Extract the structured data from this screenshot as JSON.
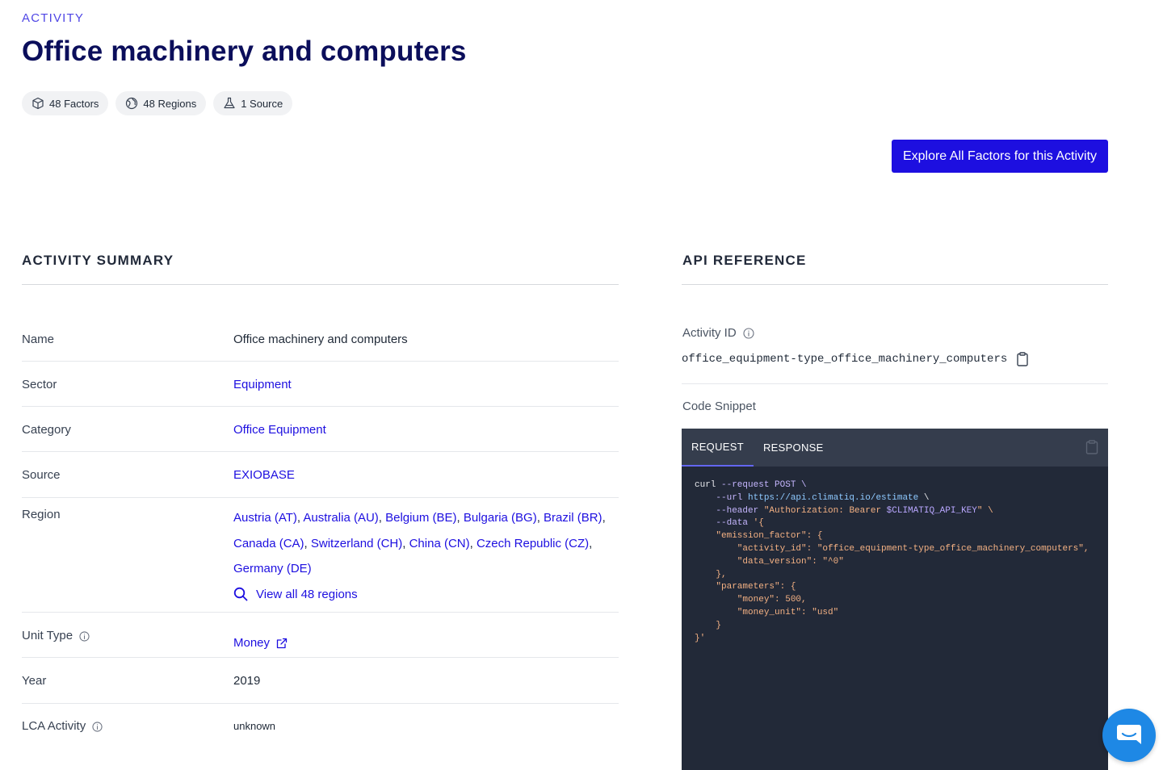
{
  "header": {
    "eyebrow": "ACTIVITY",
    "title": "Office machinery and computers"
  },
  "chips": {
    "factors": "48 Factors",
    "regions": "48 Regions",
    "sources": "1 Source"
  },
  "explore_button": "Explore All Factors for this Activity",
  "summary": {
    "heading": "ACTIVITY SUMMARY",
    "name": {
      "label": "Name",
      "value": "Office machinery and computers"
    },
    "sector": {
      "label": "Sector",
      "value": "Equipment"
    },
    "category": {
      "label": "Category",
      "value": "Office Equipment"
    },
    "source": {
      "label": "Source",
      "value": "EXIOBASE"
    },
    "region": {
      "label": "Region",
      "values": [
        "Austria (AT)",
        "Australia (AU)",
        "Belgium (BE)",
        "Bulgaria (BG)",
        "Brazil (BR)",
        "Canada (CA)",
        "Switzerland (CH)",
        "China (CN)",
        "Czech Republic (CZ)",
        "Germany (DE)"
      ],
      "view_all": "View all 48 regions"
    },
    "unit_type": {
      "label": "Unit Type",
      "value": "Money"
    },
    "year": {
      "label": "Year",
      "value": "2019"
    },
    "lca_activity": {
      "label": "LCA Activity",
      "value": "unknown"
    }
  },
  "api": {
    "heading": "API REFERENCE",
    "activity_id_label": "Activity ID",
    "activity_id": "office_equipment-type_office_machinery_computers",
    "code_snippet_label": "Code Snippet",
    "tabs": [
      "REQUEST",
      "RESPONSE"
    ],
    "code": {
      "l1_cmd": "curl",
      "l1_flag": " --request POST \\",
      "l2_flag": "    --url ",
      "l2_url": "https://api.climatiq.io/estimate",
      "l2_end": " \\",
      "l3_flag": "    --header ",
      "l3_str": "\"Authorization: Bearer ",
      "l3_var": "$CLIMATIQ_API_KEY",
      "l3_end": "\" \\",
      "l4_flag": "    --data ",
      "l4_str": "'{",
      "l5": "    \"emission_factor\": {",
      "l6": "        \"activity_id\": \"office_equipment-type_office_machinery_computers\",",
      "l7": "        \"data_version\": \"^0\"",
      "l8": "    },",
      "l9": "    \"parameters\": {",
      "l10": "        \"money\": 500,",
      "l11": "        \"money_unit\": \"usd\"",
      "l12": "    }",
      "l13": "}'"
    }
  },
  "icons": {
    "factors": "cube-icon",
    "regions": "globe-icon",
    "source": "flask-icon",
    "info": "info-icon",
    "search": "search-icon",
    "external": "external-link-icon",
    "copy": "clipboard-icon",
    "chat": "chat-icon"
  },
  "colors": {
    "title": "#0b0e5b",
    "accent": "#1d0fe0",
    "eyebrow": "#4f46e5",
    "code_bg": "#222938",
    "chat": "#1e88e5"
  }
}
